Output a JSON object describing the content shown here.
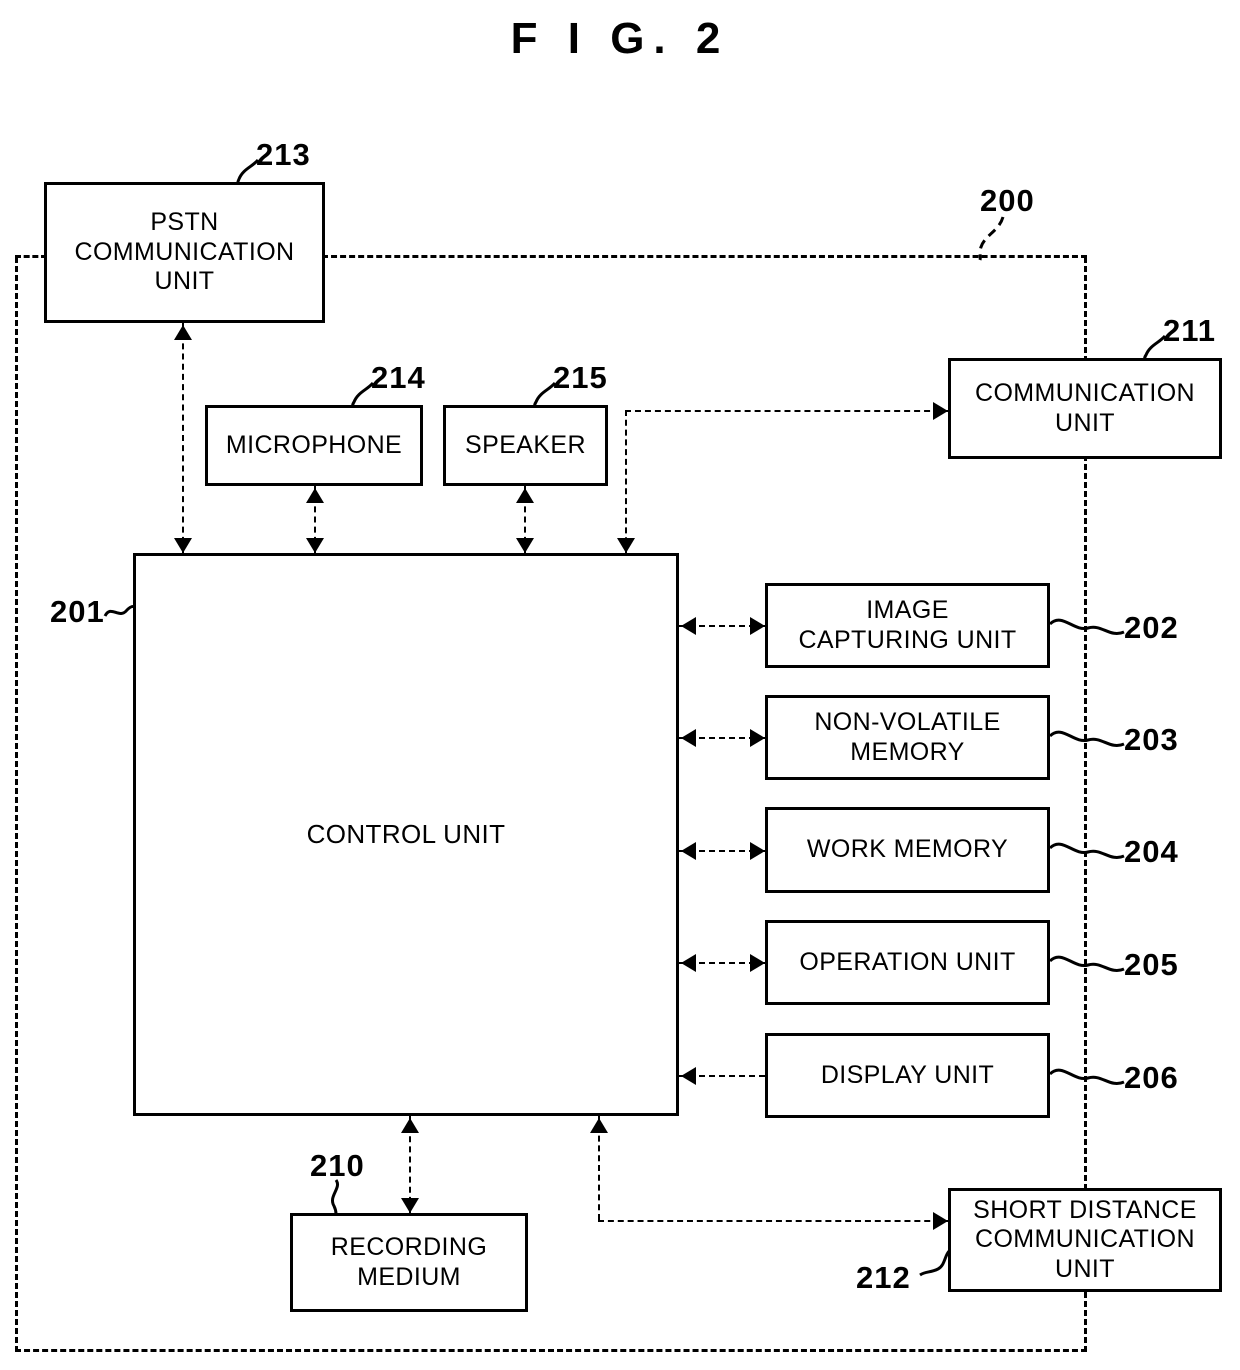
{
  "figure": {
    "title": "F I G.  2",
    "system_ref": "200"
  },
  "blocks": {
    "pstn": {
      "label": "PSTN\nCOMMUNICATION\nUNIT",
      "ref": "213"
    },
    "microphone": {
      "label": "MICROPHONE",
      "ref": "214"
    },
    "speaker": {
      "label": "SPEAKER",
      "ref": "215"
    },
    "communication": {
      "label": "COMMUNICATION\nUNIT",
      "ref": "211"
    },
    "control": {
      "label": "CONTROL UNIT",
      "ref": "201"
    },
    "image_capturing": {
      "label": "IMAGE\nCAPTURING UNIT",
      "ref": "202"
    },
    "nonvolatile_memory": {
      "label": "NON-VOLATILE\nMEMORY",
      "ref": "203"
    },
    "work_memory": {
      "label": "WORK MEMORY",
      "ref": "204"
    },
    "operation": {
      "label": "OPERATION UNIT",
      "ref": "205"
    },
    "display": {
      "label": "DISPLAY UNIT",
      "ref": "206"
    },
    "recording_medium": {
      "label": "RECORDING\nMEDIUM",
      "ref": "210"
    },
    "short_distance": {
      "label": "SHORT DISTANCE\nCOMMUNICATION\nUNIT",
      "ref": "212"
    }
  },
  "colors": {
    "ink": "#000000",
    "paper": "#ffffff"
  }
}
